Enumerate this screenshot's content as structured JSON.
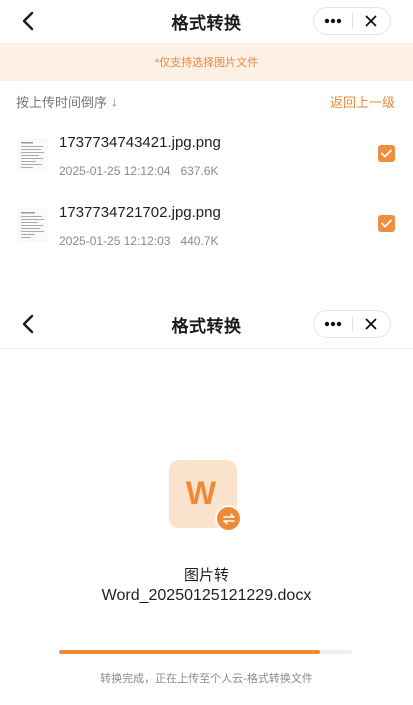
{
  "screen1": {
    "title": "格式转换",
    "notice": "*仅支持选择图片文件",
    "sort_label": "按上传时间倒序",
    "sort_arrow": "↓",
    "back_link": "返回上一级",
    "files": [
      {
        "name": "1737734743421.jpg.png",
        "date": "2025-01-25 12:12:04",
        "size": "637.6K",
        "checked": true
      },
      {
        "name": "1737734721702.jpg.png",
        "date": "2025-01-25 12:12:03",
        "size": "440.7K",
        "checked": true
      }
    ]
  },
  "screen2": {
    "title": "格式转换",
    "icon_letter": "W",
    "result_title": "图片转",
    "result_filename": "Word_20250125121229.docx",
    "progress": 0.89,
    "status": "转换完成，正在上传至个人云-格式转换文件"
  },
  "icons": {
    "back": "chevron-left-icon",
    "more": "more-dots-icon",
    "close": "close-icon",
    "check": "check-icon",
    "swap": "swap-icon"
  },
  "colors": {
    "accent": "#ee8a36",
    "notice_bg": "#fdf0e4",
    "icon_bg": "#fbe2cc"
  }
}
